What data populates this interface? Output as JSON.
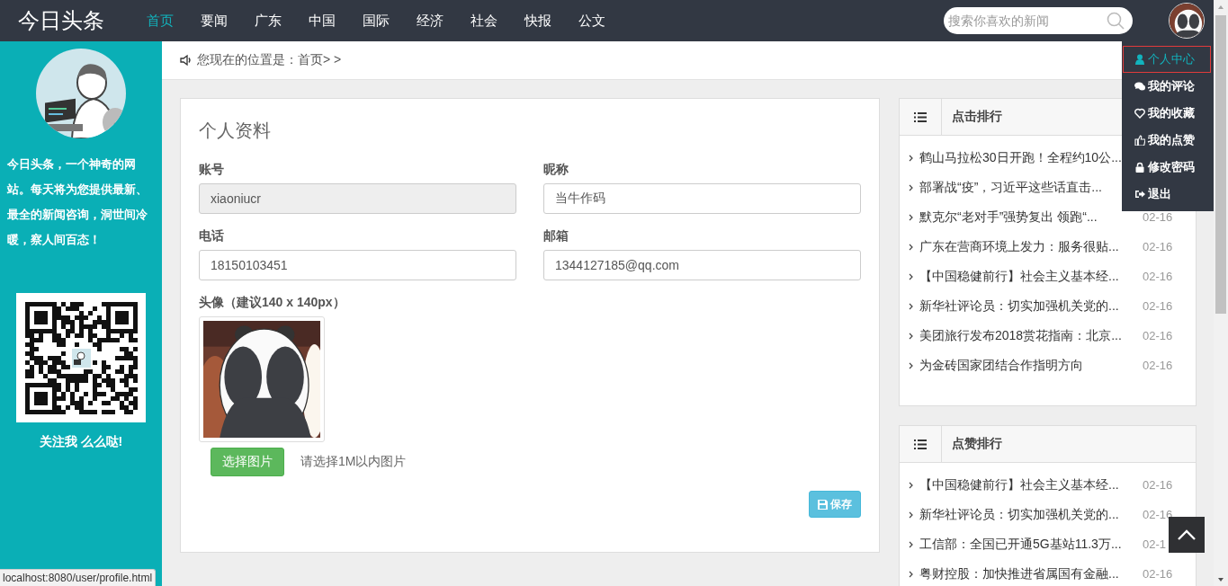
{
  "header": {
    "logo": "今日头条",
    "nav": [
      {
        "label": "首页",
        "selected": true
      },
      {
        "label": "要闻",
        "selected": false
      },
      {
        "label": "广东",
        "selected": false
      },
      {
        "label": "中国",
        "selected": false
      },
      {
        "label": "国际",
        "selected": false
      },
      {
        "label": "经济",
        "selected": false
      },
      {
        "label": "社会",
        "selected": false
      },
      {
        "label": "快报",
        "selected": false
      },
      {
        "label": "公文",
        "selected": false
      }
    ],
    "search": {
      "placeholder": "搜索你喜欢的新闻"
    }
  },
  "user_menu": {
    "items": [
      {
        "label": "个人中心",
        "kind": "user",
        "selected": true
      },
      {
        "label": "我的评论",
        "kind": "comments",
        "selected": false
      },
      {
        "label": "我的收藏",
        "kind": "heart",
        "selected": false
      },
      {
        "label": "我的点赞",
        "kind": "thumb",
        "selected": false
      },
      {
        "label": "修改密码",
        "kind": "lock",
        "selected": false
      },
      {
        "label": "退出",
        "kind": "signout",
        "selected": false
      }
    ]
  },
  "sidebar": {
    "intro": "今日头条，一个神奇的网站。每天将为您提供最新、最全的新闻咨询，洞世间冷暖，察人间百态！",
    "qr_caption": "关注我 么么哒!"
  },
  "breadcrumb": "您现在的位置是：首页> >",
  "profile": {
    "title": "个人资料",
    "fields": [
      {
        "label": "账号",
        "value": "xiaoniucr",
        "disabled": true
      },
      {
        "label": "昵称",
        "value": "当牛作码",
        "disabled": false
      },
      {
        "label": "电话",
        "value": "18150103451",
        "disabled": false
      },
      {
        "label": "邮箱",
        "value": "1344127185@qq.com",
        "disabled": false
      }
    ],
    "avatar_label": "头像（建议140 x 140px）",
    "choose_button": "选择图片",
    "hint": "请选择1M以内图片",
    "save_button": "保存"
  },
  "panels": [
    {
      "title": "点击排行",
      "items": [
        {
          "title": "鹤山马拉松30日开跑！全程约10公..."
        },
        {
          "title": "部署战“疫”，习近平这些话直击..."
        },
        {
          "title": "默克尔“老对手”强势复出 领跑“...",
          "date": "02-16"
        },
        {
          "title": "广东在营商环境上发力：服务很贴...",
          "date": "02-16"
        },
        {
          "title": "【中国稳健前行】社会主义基本经...",
          "date": "02-16"
        },
        {
          "title": "新华社评论员：切实加强机关党的...",
          "date": "02-16"
        },
        {
          "title": "美团旅行发布2018赏花指南：北京...",
          "date": "02-16"
        },
        {
          "title": "为金砖国家团结合作指明方向",
          "date": "02-16"
        }
      ]
    },
    {
      "title": "点赞排行",
      "items": [
        {
          "title": "【中国稳健前行】社会主义基本经...",
          "date": "02-16"
        },
        {
          "title": "新华社评论员：切实加强机关党的...",
          "date": "02-16"
        },
        {
          "title": "工信部：全国已开通5G基站11.3万...",
          "date": "02-1"
        },
        {
          "title": "粤财控股：加快推进省属国有金融...",
          "date": "02-16"
        }
      ]
    }
  ],
  "status_bar": "localhost:8080/user/profile.html"
}
